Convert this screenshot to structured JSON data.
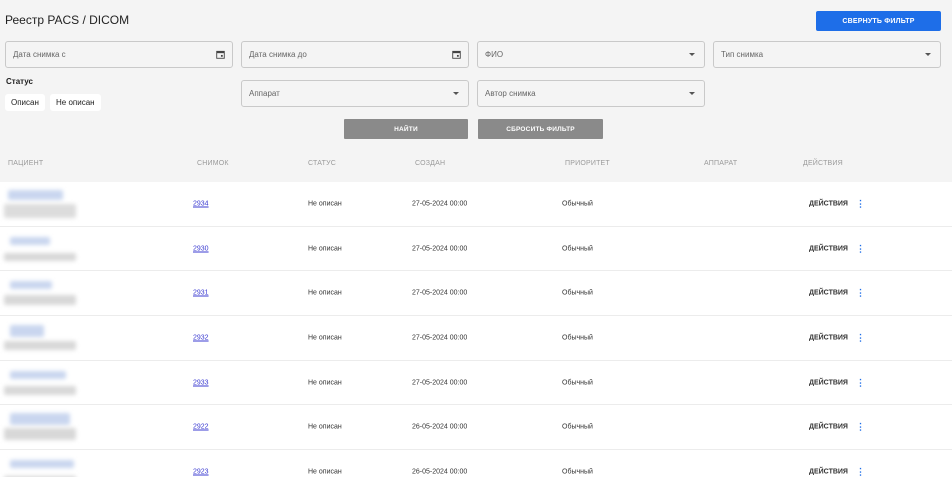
{
  "header": {
    "title": "Реестр PACS / DICOM",
    "collapse_filter_label": "Свернуть фильтр"
  },
  "filters": {
    "date_from_placeholder": "Дата снимка с",
    "date_to_placeholder": "Дата снимка до",
    "fio_placeholder": "ФИО",
    "image_type_placeholder": "Тип снимка",
    "device_placeholder": "Аппарат",
    "author_placeholder": "Автор снимка",
    "status_label": "Статус",
    "status_options": [
      "Описан",
      "Не описан"
    ],
    "find_label": "Найти",
    "reset_label": "Сбросить фильтр"
  },
  "table": {
    "headers": {
      "patient": "Пациент",
      "image": "Снимок",
      "status": "Статус",
      "created": "Создан",
      "priority": "Приоритет",
      "device": "Аппарат",
      "actions": "Действия"
    },
    "rows": [
      {
        "image": "2934",
        "status": "Не описан",
        "created": "27-05-2024 00:00",
        "priority": "Обычный",
        "device": "",
        "actions": "ДЕЙСТВИЯ"
      },
      {
        "image": "2930",
        "status": "Не описан",
        "created": "27-05-2024 00:00",
        "priority": "Обычный",
        "device": "",
        "actions": "ДЕЙСТВИЯ"
      },
      {
        "image": "2931",
        "status": "Не описан",
        "created": "27-05-2024 00:00",
        "priority": "Обычный",
        "device": "",
        "actions": "ДЕЙСТВИЯ"
      },
      {
        "image": "2932",
        "status": "Не описан",
        "created": "27-05-2024 00:00",
        "priority": "Обычный",
        "device": "",
        "actions": "ДЕЙСТВИЯ"
      },
      {
        "image": "2933",
        "status": "Не описан",
        "created": "27-05-2024 00:00",
        "priority": "Обычный",
        "device": "",
        "actions": "ДЕЙСТВИЯ"
      },
      {
        "image": "2922",
        "status": "Не описан",
        "created": "26-05-2024 00:00",
        "priority": "Обычный",
        "device": "",
        "actions": "ДЕЙСТВИЯ"
      },
      {
        "image": "2923",
        "status": "Не описан",
        "created": "26-05-2024 00:00",
        "priority": "Обычный",
        "device": "",
        "actions": "ДЕЙСТВИЯ"
      }
    ]
  },
  "colors": {
    "accent": "#1e6ee8",
    "link": "#3b3bd1",
    "button_gray": "#8a8a8a",
    "background": "#f4f4f4"
  }
}
